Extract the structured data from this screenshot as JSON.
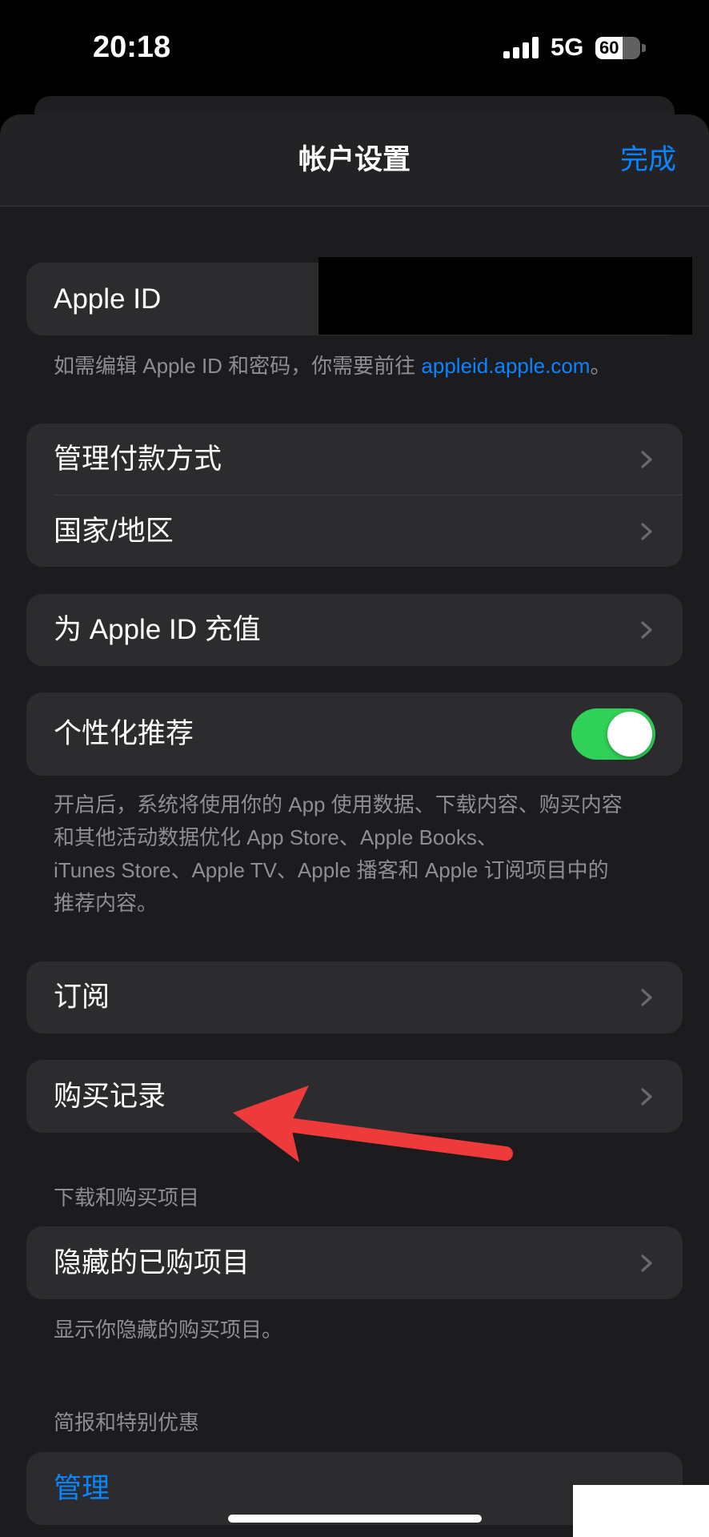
{
  "status_bar": {
    "time": "20:18",
    "network": "5G",
    "battery_level": "60",
    "signal_bars": 4
  },
  "nav": {
    "title": "帐户设置",
    "done_label": "完成"
  },
  "apple_id": {
    "label": "Apple ID",
    "footer_prefix": "如需编辑 Apple ID 和密码，你需要前往 ",
    "footer_link": "appleid.apple.com",
    "footer_suffix": "。"
  },
  "payment": {
    "items": [
      {
        "label": "管理付款方式"
      },
      {
        "label": "国家/地区"
      }
    ]
  },
  "top_up": {
    "label": "为 Apple ID 充值"
  },
  "personalization": {
    "label": "个性化推荐",
    "enabled": true,
    "description_lines": [
      "开启后，系统将使用你的 App 使用数据、下载内容、购买内容",
      "和其他活动数据优化 App Store、Apple Books、",
      "iTunes Store、Apple TV、Apple 播客和 Apple 订阅项目中的",
      "推荐内容。"
    ]
  },
  "subscriptions": {
    "label": "订阅"
  },
  "purchase_history": {
    "label": "购买记录"
  },
  "downloads": {
    "header": "下载和购买项目",
    "items": [
      {
        "label": "隐藏的已购项目"
      }
    ],
    "footer": "显示你隐藏的购买项目。"
  },
  "newsletters": {
    "header": "简报和特别优惠",
    "manage_label": "管理"
  },
  "icons": {
    "disclosure": "chevron-right-icon",
    "signal": "cellular-signal-icon",
    "battery": "battery-icon"
  },
  "colors": {
    "accent": "#0a84ff",
    "toggle_on": "#30d158",
    "annotation_arrow": "#ee3a3a",
    "row_background": "#2c2c2e",
    "sheet_background": "#1c1c1e",
    "secondary_text": "#8d8d93"
  }
}
